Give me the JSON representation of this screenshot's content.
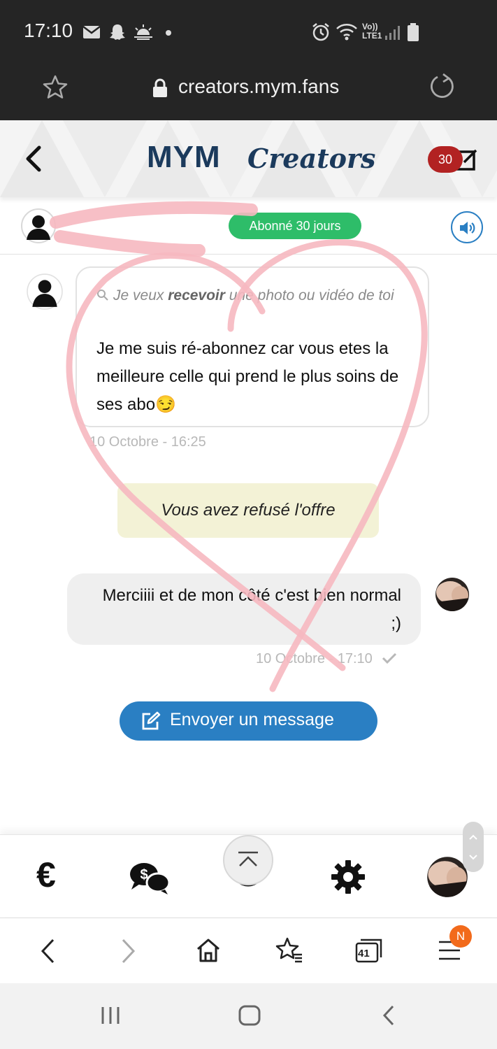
{
  "status_bar": {
    "time": "17:10",
    "network_label_top": "Vo))",
    "network_label_bottom": "LTE1"
  },
  "browser": {
    "url": "creators.mym.fans"
  },
  "header": {
    "brand_mym": "MYM",
    "brand_creators": "Creators",
    "notification_count": "30"
  },
  "contact": {
    "subscription_badge": "Abonné 30 jours"
  },
  "chat": {
    "incoming": {
      "quote_prefix": "Je veux ",
      "quote_bold": "recevoir",
      "quote_suffix": " une photo ou vidéo de toi",
      "message": "Je me suis ré-abonnez car vous etes la meilleure celle qui prend le plus soins de ses abo😏",
      "time": "10 Octobre - 16:25"
    },
    "offer_status": "Vous avez refusé l'offre",
    "outgoing": {
      "message": "Merciiii et de mon côté c'est bien normal ;)",
      "time": "10 Octobre - 17:10"
    },
    "send_button_label": "Envoyer un message"
  },
  "bottom_nav": {
    "euro_symbol": "€",
    "items": [
      "euro-icon",
      "paid-messages-icon",
      "home-icon",
      "settings-icon",
      "profile-avatar"
    ]
  },
  "browser_nav": {
    "tabs_count": "41",
    "menu_badge": "N"
  },
  "colors": {
    "accent_blue": "#2a7fc3",
    "subscription_green": "#2ebd69",
    "badge_red": "#b22222",
    "brand_navy": "#1b3a5c",
    "menu_badge_orange": "#f26a1b",
    "overlay_pink": "#f6b8c0"
  }
}
